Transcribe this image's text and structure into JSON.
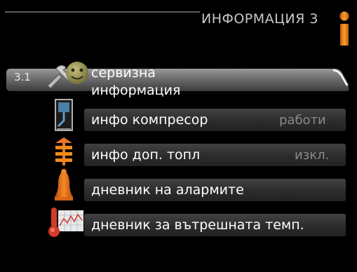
{
  "header": {
    "title": "ИНФОРМАЦИЯ 3"
  },
  "selected": {
    "number": "3.1"
  },
  "items": [
    {
      "label_line1": "сервизна",
      "label_line2": "информация",
      "icon": "wrench-smiley-icon"
    },
    {
      "label": "инфо компресор",
      "value": "работи",
      "icon": "compressor-icon"
    },
    {
      "label": "инфо доп. топл",
      "value": "изкл.",
      "icon": "heater-icon"
    },
    {
      "label": "дневник на алармите",
      "icon": "alarm-bell-icon"
    },
    {
      "label": "дневник за вътрешната темп.",
      "icon": "temperature-graph-icon"
    }
  ],
  "colors": {
    "accent_orange": "#f08a1c",
    "background": "#000000",
    "value_grey": "#8a8a8a"
  }
}
